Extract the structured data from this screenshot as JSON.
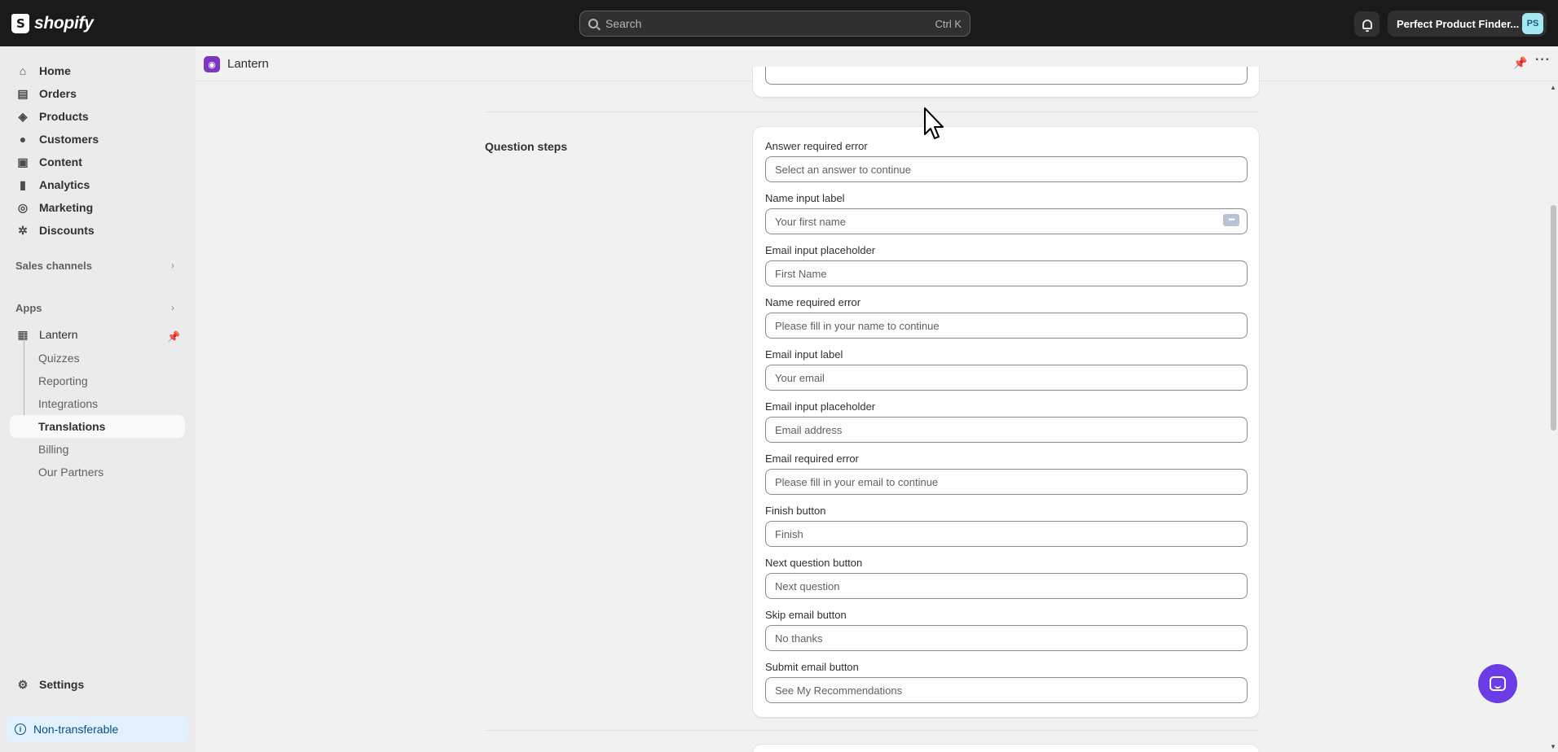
{
  "topbar": {
    "brand": "shopify",
    "search_placeholder": "Search",
    "search_shortcut": "Ctrl K",
    "store_name": "Perfect Product Finder...",
    "avatar_initials": "PS"
  },
  "sidebar": {
    "items": [
      {
        "label": "Home",
        "icon": "home-icon"
      },
      {
        "label": "Orders",
        "icon": "inbox-icon"
      },
      {
        "label": "Products",
        "icon": "tag-icon"
      },
      {
        "label": "Customers",
        "icon": "person-icon"
      },
      {
        "label": "Content",
        "icon": "image-icon"
      },
      {
        "label": "Analytics",
        "icon": "bar-chart-icon"
      },
      {
        "label": "Marketing",
        "icon": "target-icon"
      },
      {
        "label": "Discounts",
        "icon": "discount-icon"
      }
    ],
    "sales_channels": "Sales channels",
    "apps": "Apps",
    "app_name": "Lantern",
    "app_subitems": [
      "Quizzes",
      "Reporting",
      "Integrations",
      "Translations",
      "Billing",
      "Our Partners"
    ],
    "active_subitem": "Translations",
    "settings": "Settings",
    "non_transferable": "Non-transferable"
  },
  "app_header": {
    "title": "Lantern"
  },
  "main": {
    "section_title": "Question steps",
    "fields": [
      {
        "label": "Answer required error",
        "value": "Select an answer to continue"
      },
      {
        "label": "Name input label",
        "value": "Your first name"
      },
      {
        "label": "Email input placeholder",
        "value": "First Name"
      },
      {
        "label": "Name required error",
        "value": "Please fill in your name to continue"
      },
      {
        "label": "Email input label",
        "value": "Your email"
      },
      {
        "label": "Email input placeholder",
        "value": "Email address"
      },
      {
        "label": "Email required error",
        "value": "Please fill in your email to continue"
      },
      {
        "label": "Finish button",
        "value": "Finish"
      },
      {
        "label": "Next question button",
        "value": "Next question"
      },
      {
        "label": "Skip email button",
        "value": "No thanks"
      },
      {
        "label": "Submit email button",
        "value": "See My Recommendations"
      }
    ]
  },
  "colors": {
    "topbar_bg": "#1a1a1a",
    "sidebar_bg": "#ebebeb",
    "chat_accent": "#6c3ce6",
    "app_logo": "#7b36c2",
    "info_bar": "#e3f1fe"
  }
}
